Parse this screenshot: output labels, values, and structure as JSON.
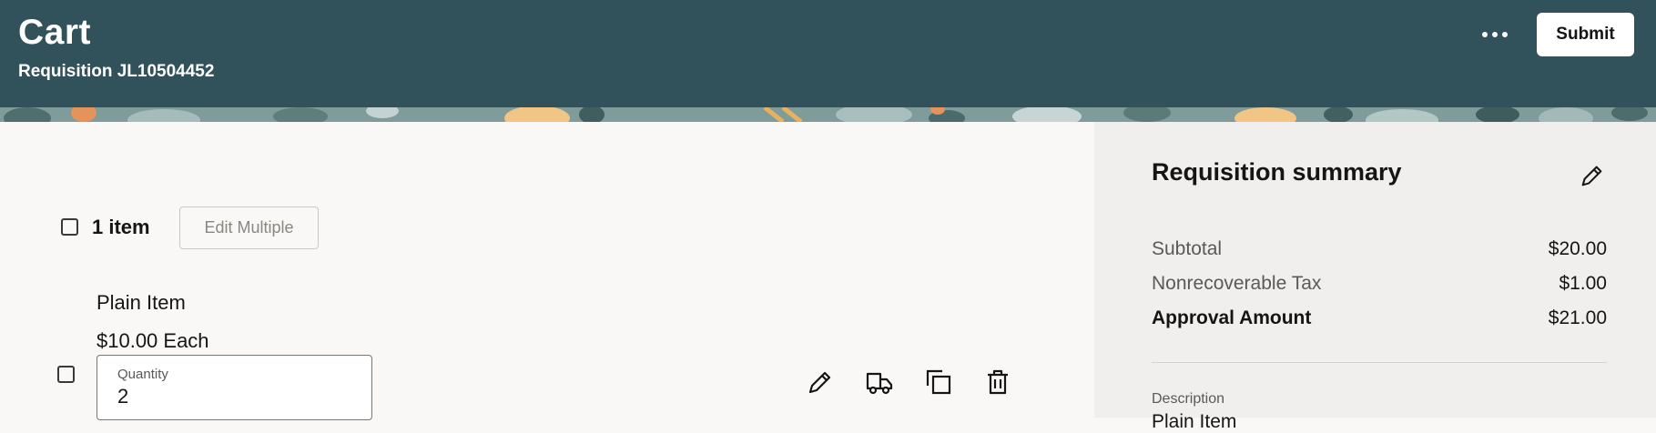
{
  "header": {
    "title": "Cart",
    "subtitle": "Requisition JL10504452",
    "submit_label": "Submit",
    "more_icon": "more-horizontal-icon"
  },
  "colors": {
    "header_bg": "#31525a",
    "page_bg": "#f9f8f6",
    "panel_bg": "#f1efed"
  },
  "cart": {
    "item_count": "1 item",
    "edit_multiple_label": "Edit Multiple",
    "items": [
      {
        "name": "Plain Item",
        "price": "$10.00 Each",
        "quantity_label": "Quantity",
        "quantity": "2",
        "action_icons": [
          "edit-icon",
          "truck-icon",
          "copy-icon",
          "trash-icon"
        ]
      }
    ]
  },
  "summary": {
    "title": "Requisition summary",
    "rows": [
      {
        "label": "Subtotal",
        "value": "$20.00"
      },
      {
        "label": "Nonrecoverable Tax",
        "value": "$1.00"
      },
      {
        "label": "Approval Amount",
        "value": "$21.00"
      }
    ],
    "description_label": "Description",
    "description_value": "Plain Item"
  }
}
